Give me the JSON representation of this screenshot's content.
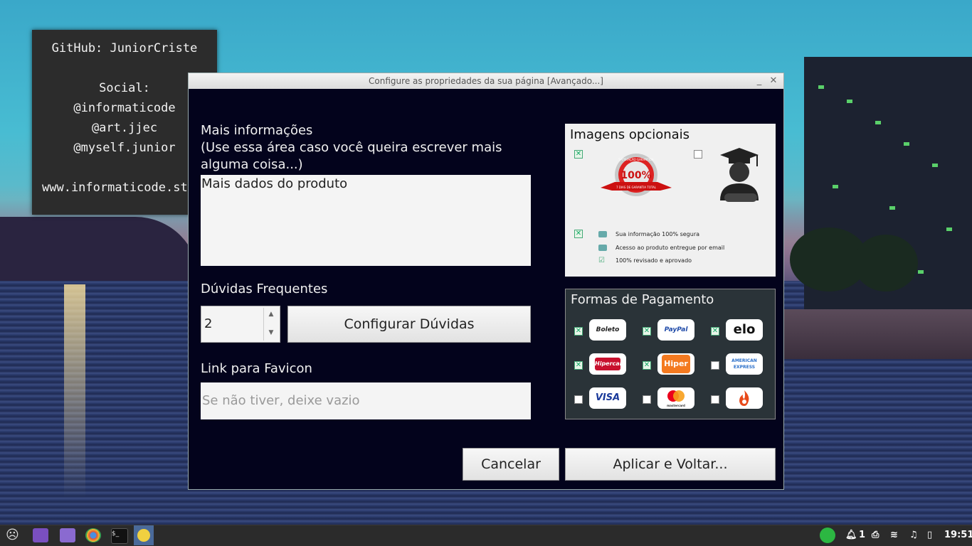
{
  "chalkboard": {
    "lines": [
      "GitHub: JuniorCriste",
      "Social:",
      "@informaticode",
      "@art.jjec",
      "@myself.junior",
      "www.informaticode.store"
    ]
  },
  "dialog": {
    "title": "Configure as propriedades da sua página [Avançado...]",
    "minimize": "_",
    "close": "✕",
    "mais_info_label": "Mais informações\n(Use essa área caso você queira escrever mais\nalguma coisa...)",
    "mais_info_value": "Mais dados do produto",
    "duvidas_label": "Dúvidas Frequentes",
    "duvidas_count": "2",
    "config_duvidas_button": "Configurar Dúvidas",
    "favicon_label": "Link para Favicon",
    "favicon_placeholder": "Se não tiver, deixe vazio",
    "cancel_button": "Cancelar",
    "apply_button": "Aplicar e Voltar..."
  },
  "images_panel": {
    "title": "Imagens opcionais",
    "guarantee_checked": true,
    "graduate_checked": false,
    "info_checked": true,
    "info_lines": [
      "Sua informação 100% segura",
      "Acesso ao produto entregue por email",
      "100% revisado e aprovado"
    ],
    "seal_text": "100%",
    "seal_ribbon": "7 DIAS DE GARANTIA TOTAL",
    "seal_arc": "SATISFAÇÃO GARANTIDA"
  },
  "payment_panel": {
    "title": "Formas de Pagamento",
    "methods": [
      {
        "name": "Boleto",
        "checked": true,
        "color": "#222222"
      },
      {
        "name": "PayPal",
        "checked": true,
        "color": "#1f4aa8"
      },
      {
        "name": "elo",
        "checked": true,
        "color": "#111111"
      },
      {
        "name": "Hipercard",
        "checked": true,
        "color": "#ffffff"
      },
      {
        "name": "Hiper",
        "checked": true,
        "color": "#ffffff"
      },
      {
        "name": "AMERICAN EXPRESS",
        "checked": false,
        "color": "#2a6fc9"
      },
      {
        "name": "VISA",
        "checked": false,
        "color": "#1a3a9a"
      },
      {
        "name": "mastercard",
        "checked": false,
        "color": "#333333"
      },
      {
        "name": "",
        "checked": false,
        "color": "#e84a1a"
      }
    ]
  },
  "taskbar": {
    "notifications_count": "1",
    "clock": "19:51"
  }
}
